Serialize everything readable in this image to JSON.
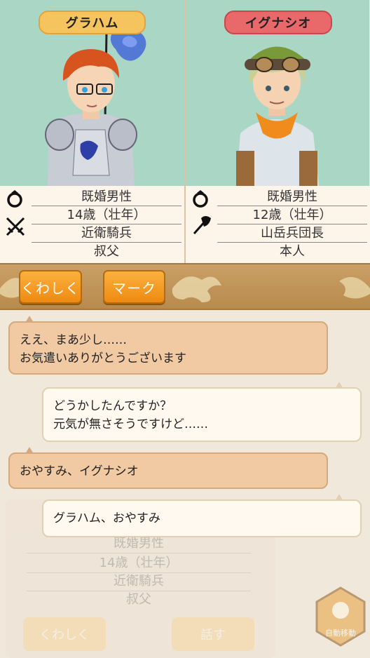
{
  "left_character": {
    "name": "グラハム",
    "marital": "既婚男性",
    "age": "14歳（壮年）",
    "job": "近衛騎兵",
    "relation": "叔父"
  },
  "right_character": {
    "name": "イグナシオ",
    "marital": "既婚男性",
    "age": "12歳（壮年）",
    "job": "山岳兵団長",
    "relation": "本人"
  },
  "icons": {
    "marital": "ring-icon",
    "left_job": "crossed-swords-icon",
    "right_job": "axe-icon"
  },
  "buttons": {
    "details": "くわしく",
    "mark": "マーク"
  },
  "messages": [
    {
      "side": "left",
      "line1": "ええ、まあ少し……",
      "line2": "お気遣いありがとうございます"
    },
    {
      "side": "right",
      "line1": "どうかしたんですか？",
      "line2": "元気が無さそうですけど……"
    },
    {
      "side": "left",
      "line1": "おやすみ、イグナシオ"
    },
    {
      "side": "right",
      "line1": "グラハム、おやすみ"
    }
  ],
  "background_card": {
    "marital": "既婚男性",
    "age": "14歳（壮年）",
    "job": "近衛騎兵",
    "relation": "叔父",
    "details_label": "くわしく",
    "talk_label": "話す",
    "auto_label": "自動移動"
  },
  "colors": {
    "portrait_bg": "#a9d6c5",
    "left_tag": "#f6c45e",
    "right_tag": "#e9686a",
    "button": "#f29a1f",
    "bar": "#c39a5f"
  }
}
